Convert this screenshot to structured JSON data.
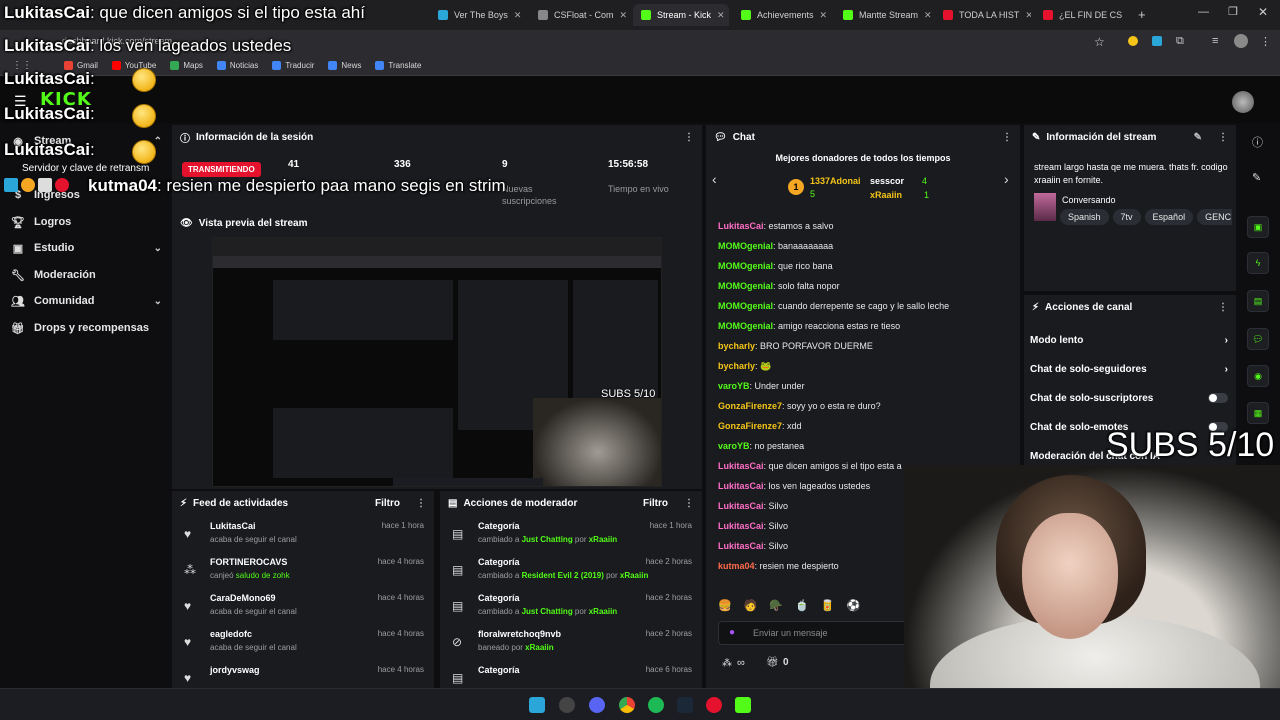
{
  "browser": {
    "tabs": [
      {
        "label": "Ver The Boys",
        "color": "#2aa6d8"
      },
      {
        "label": "CSFloat - Com",
        "color": "#888888"
      },
      {
        "label": "Stream - Kick",
        "color": "#53fc18"
      },
      {
        "label": "Achievements",
        "color": "#53fc18"
      },
      {
        "label": "Mantte Stream",
        "color": "#53fc18"
      },
      {
        "label": "TODA LA HIST",
        "color": "#e5122d"
      },
      {
        "label": "¿EL FIN DE CS",
        "color": "#e5122d"
      }
    ],
    "address": "dashboard.kick.com/stream",
    "bookmarks": [
      "Gmail",
      "YouTube",
      "Maps",
      "Noticias",
      "Traducir",
      "News",
      "Translate"
    ]
  },
  "sidebar": {
    "items": [
      {
        "label": "Stream",
        "icon": "stream-icon"
      },
      {
        "label": "Ingresos",
        "icon": "dollar-icon"
      },
      {
        "label": "Logros",
        "icon": "trophy-icon"
      },
      {
        "label": "Estudio",
        "icon": "studio-icon"
      },
      {
        "label": "Moderación",
        "icon": "wrench-icon"
      },
      {
        "label": "Comunidad",
        "icon": "people-icon"
      },
      {
        "label": "Drops y recompensas",
        "icon": "gift-icon"
      }
    ],
    "stream_key_label": "Servidor y clave de retransm"
  },
  "session": {
    "title": "Información de la sesión",
    "live_badge": "TRANSMITIENDO",
    "stats": [
      {
        "value": "41",
        "label": ""
      },
      {
        "value": "336",
        "label": ""
      },
      {
        "value": "9",
        "label": "Nuevas suscripciones"
      },
      {
        "value": "15:56:58",
        "label": "Tiempo en vivo"
      }
    ]
  },
  "preview": {
    "title": "Vista previa del stream",
    "subs_overlay": "SUBS 5/10"
  },
  "activity": {
    "title": "Feed de actividades",
    "filter": "Filtro",
    "rows": [
      {
        "name": "LukitasCai",
        "desc": "acaba de seguir el canal",
        "time": "hace 1 hora",
        "icon": "heart-icon"
      },
      {
        "name": "FORTINEROCAVS",
        "desc": "canjeó ",
        "extra": "saludo de zohk",
        "time": "hace 4 horas",
        "icon": "points-icon"
      },
      {
        "name": "CaraDeMono69",
        "desc": "acaba de seguir el canal",
        "time": "hace 4 horas",
        "icon": "heart-icon"
      },
      {
        "name": "eagledofc",
        "desc": "acaba de seguir el canal",
        "time": "hace 4 horas",
        "icon": "heart-icon"
      },
      {
        "name": "jordyvswag",
        "desc": "",
        "time": "hace 4 horas",
        "icon": "heart-icon"
      }
    ]
  },
  "modactions": {
    "title": "Acciones de moderador",
    "filter": "Filtro",
    "rows": [
      {
        "name": "Categoría",
        "pre": "cambiado a ",
        "mid": "Just Chatting",
        "by": " por ",
        "who": "xRaaiin",
        "time": "hace 1 hora",
        "icon": "category-icon"
      },
      {
        "name": "Categoría",
        "pre": "cambiado a ",
        "mid": "Resident Evil 2 (2019)",
        "by": " por ",
        "who": "xRaaiin",
        "time": "hace 2 horas",
        "icon": "category-icon"
      },
      {
        "name": "Categoría",
        "pre": "cambiado a ",
        "mid": "Just Chatting",
        "by": " por ",
        "who": "xRaaiin",
        "time": "hace 2 horas",
        "icon": "category-icon"
      },
      {
        "name": "floralwretchoq9nvb",
        "pre": "baneado por ",
        "mid": "",
        "by": "",
        "who": "xRaaiin",
        "time": "hace 2 horas",
        "icon": "ban-icon"
      },
      {
        "name": "Categoría",
        "pre": "",
        "mid": "",
        "by": "",
        "who": "",
        "time": "hace 6 horas",
        "icon": "category-icon"
      }
    ]
  },
  "chat": {
    "title": "Chat",
    "top_donors_title": "Mejores donadores de todos los tiempos",
    "donors": [
      {
        "rank": "1",
        "name": "1337Adonai",
        "amount": "5"
      },
      {
        "name": "sesscor",
        "amount": "4"
      },
      {
        "name": "xRaaiin",
        "amount": "1"
      }
    ],
    "messages": [
      {
        "user": "LukitasCai",
        "color": "#ff6ec7",
        "text": "estamos a salvo"
      },
      {
        "user": "MOMOgenial",
        "color": "#53fc18",
        "text": "banaaaaaaaa"
      },
      {
        "user": "MOMOgenial",
        "color": "#53fc18",
        "text": "que rico bana"
      },
      {
        "user": "MOMOgenial",
        "color": "#53fc18",
        "text": "solo falta nopor"
      },
      {
        "user": "MOMOgenial",
        "color": "#53fc18",
        "text": "cuando derrepente se cago y le sallo leche"
      },
      {
        "user": "MOMOgenial",
        "color": "#53fc18",
        "text": "amigo reacciona estas re tieso"
      },
      {
        "user": "bycharly",
        "color": "#f5c518",
        "text": "BRO PORFAVOR DUERME"
      },
      {
        "user": "bycharly",
        "color": "#f5c518",
        "text": "🐸"
      },
      {
        "user": "varoYB",
        "color": "#53fc18",
        "text": "Under under"
      },
      {
        "user": "GonzaFirenze7",
        "color": "#f5c518",
        "text": "soyy yo o esta re duro?"
      },
      {
        "user": "GonzaFirenze7",
        "color": "#f5c518",
        "text": "xdd"
      },
      {
        "user": "varoYB",
        "color": "#53fc18",
        "text": "no pestanea"
      },
      {
        "user": "LukitasCai",
        "color": "#ff6ec7",
        "text": "que dicen amigos si el tipo esta a"
      },
      {
        "user": "LukitasCai",
        "color": "#ff6ec7",
        "text": "los ven lageados ustedes"
      },
      {
        "user": "LukitasCai",
        "color": "#ff6ec7",
        "text": "Silvo"
      },
      {
        "user": "LukitasCai",
        "color": "#ff6ec7",
        "text": "Silvo"
      },
      {
        "user": "LukitasCai",
        "color": "#ff6ec7",
        "text": "Silvo"
      },
      {
        "user": "kutma04",
        "color": "#ff6b4a",
        "text": "resien me despierto"
      }
    ],
    "input_placeholder": "Enviar un mensaje",
    "points": "∞",
    "gifts": "0"
  },
  "stream_info": {
    "title": "Información del stream",
    "text": "stream largo hasta qe me muera. thats fr. codigo xraaiin en fornite.",
    "category": "Conversando",
    "tags": [
      "Spanish",
      "7tv",
      "Español",
      "GENC"
    ]
  },
  "channel_actions": {
    "title": "Acciones de canal",
    "items": [
      {
        "label": "Modo lento",
        "kind": "chevron"
      },
      {
        "label": "Chat de solo-seguidores",
        "kind": "chevron"
      },
      {
        "label": "Chat de solo-suscriptores",
        "kind": "toggle"
      },
      {
        "label": "Chat de solo-emotes",
        "kind": "toggle"
      },
      {
        "label": "Moderación del chat con IA",
        "kind": "none"
      }
    ]
  },
  "overlays": {
    "chat_lines": [
      {
        "user": "LukitasCai",
        "text": ": que dicen amigos si el tipo esta ahí"
      },
      {
        "user": "LukitasCai",
        "text": ": los ven lageados ustedes"
      },
      {
        "user": "LukitasCai",
        "text": ":"
      },
      {
        "user": "LukitasCai",
        "text": ":"
      },
      {
        "user": "LukitasCai",
        "text": ":"
      },
      {
        "user": "kutma04",
        "text": ": resien me despierto paa mano segis en strim"
      }
    ],
    "subs_big": "SUBS 5/10"
  },
  "colors": {
    "accent": "#53fc18",
    "live": "#e5122d",
    "panel": "#191b1f"
  }
}
